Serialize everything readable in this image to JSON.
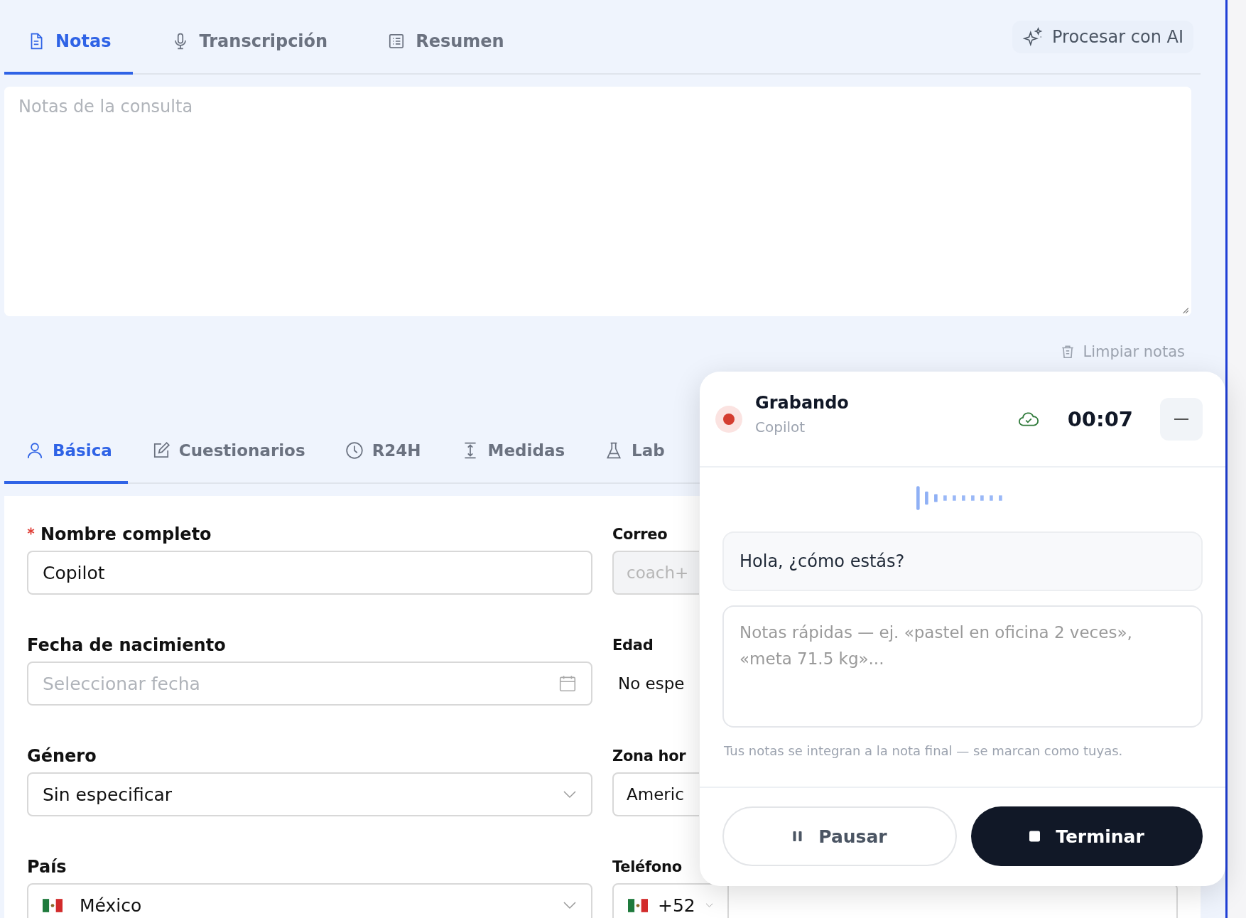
{
  "top_tabs": [
    {
      "label": "Notas",
      "selected": true
    },
    {
      "label": "Transcripción",
      "selected": false
    },
    {
      "label": "Resumen",
      "selected": false
    }
  ],
  "ai_button": {
    "label": "Procesar con AI"
  },
  "notes": {
    "placeholder": "Notas de la consulta"
  },
  "clear_button": {
    "label": "Limpiar notas"
  },
  "form_tabs": [
    {
      "label": "Básica",
      "selected": true
    },
    {
      "label": "Cuestionarios",
      "selected": false
    },
    {
      "label": "R24H",
      "selected": false
    },
    {
      "label": "Medidas",
      "selected": false
    },
    {
      "label": "Lab",
      "selected": false
    }
  ],
  "form_left": [
    {
      "kind": "text",
      "label": "Nombre completo",
      "required": true,
      "disabled": false,
      "value": "Copilot"
    },
    {
      "kind": "date",
      "label": "Fecha de nacimiento",
      "required": false,
      "disabled": false,
      "placeholder": "Seleccionar fecha"
    },
    {
      "kind": "select",
      "label": "Género",
      "required": false,
      "disabled": false,
      "value": "Sin especificar"
    },
    {
      "kind": "country",
      "label": "País",
      "required": false,
      "disabled": false,
      "value": "México"
    }
  ],
  "form_right": [
    {
      "kind": "text",
      "label": "Correo",
      "required": false,
      "disabled": true,
      "placeholder": "coach+"
    },
    {
      "kind": "static",
      "label": "Edad",
      "required": false,
      "disabled": false,
      "value": "No espe"
    },
    {
      "kind": "select",
      "label": "Zona hor",
      "required": false,
      "disabled": false,
      "value": "Americ"
    },
    {
      "kind": "phone",
      "label": "Teléfono",
      "required": false,
      "disabled": false,
      "value": "+52"
    }
  ],
  "recorder": {
    "recording": true,
    "status": "Grabando",
    "subtitle": "Copilot",
    "time": "00:07",
    "transcript": "Hola, ¿cómo estás?",
    "notes_placeholder": "Notas rápidas — ej. «pastel en oficina 2 veces», «meta 71.5 kg»...",
    "hint": "Tus notas se integran a la nota final — se marcan como tuyas.",
    "pause_label": "Pausar",
    "stop_label": "Terminar"
  }
}
